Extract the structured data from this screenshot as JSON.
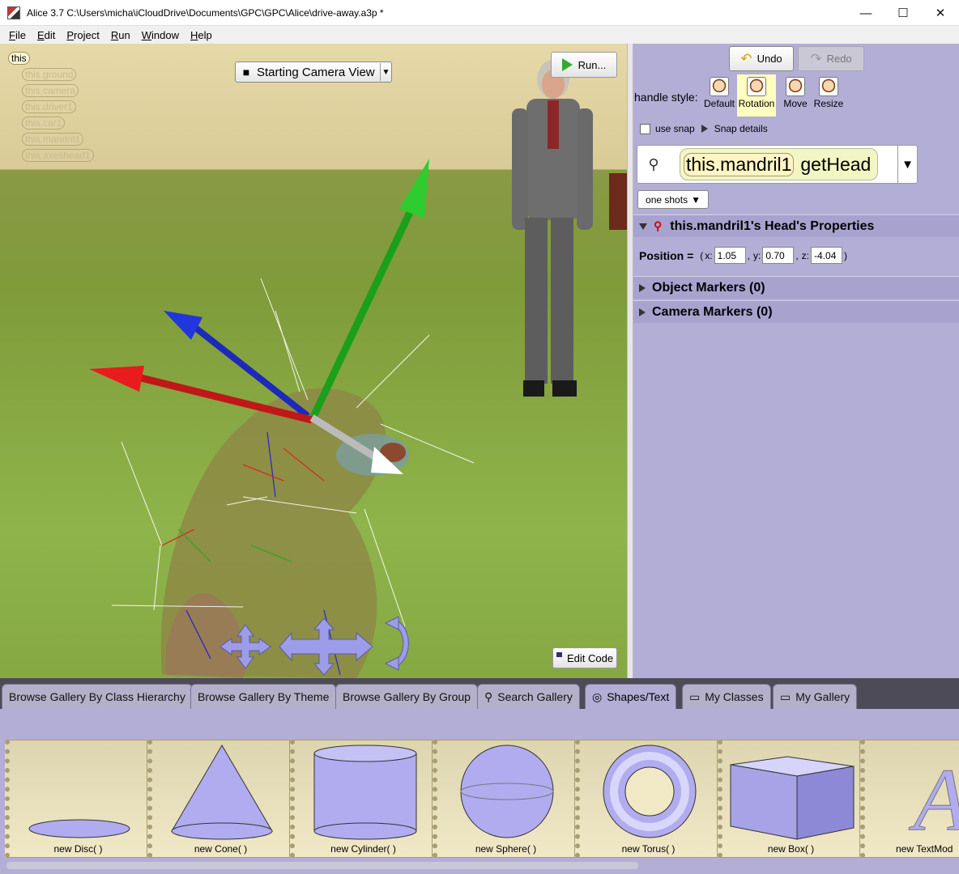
{
  "window": {
    "title": "Alice 3.7 C:\\Users\\micha\\iCloudDrive\\Documents\\GPC\\GPC\\Alice\\drive-away.a3p *",
    "controls": {
      "minimize": "—",
      "maximize": "☐",
      "close": "✕"
    }
  },
  "menu": [
    "File",
    "Edit",
    "Project",
    "Run",
    "Window",
    "Help"
  ],
  "scene": {
    "tree": [
      "this",
      "this.ground",
      "this.camera",
      "this.driver1",
      "this.car1",
      "this.mandril1",
      "this.axeshead1"
    ],
    "camera_view": "Starting Camera View",
    "run_label": "Run...",
    "edit_code_label": "Edit Code"
  },
  "panel": {
    "undo": "Undo",
    "redo": "Redo",
    "handle_style_label": "handle style:",
    "handle_styles": [
      "Default",
      "Rotation",
      "Move",
      "Resize"
    ],
    "selected_handle_style": "Rotation",
    "use_snap": "use snap",
    "snap_details": "Snap details",
    "selector": {
      "object": "this.mandril1",
      "method": "getHead"
    },
    "one_shots": "one shots",
    "properties_title": "this.mandril1's Head's Properties",
    "position": {
      "label": "Position =",
      "x_label": "x:",
      "x": "1.05",
      "y_label": "y:",
      "y": "0.70",
      "z_label": "z:",
      "z": "-4.04"
    },
    "object_markers": "Object Markers (0)",
    "camera_markers": "Camera Markers (0)"
  },
  "gallery": {
    "tabs": [
      "Browse Gallery By Class Hierarchy",
      "Browse Gallery By Theme",
      "Browse Gallery By Group",
      "Search Gallery",
      "Shapes/Text",
      "My Classes",
      "My Gallery"
    ],
    "active_tab": "Shapes/Text",
    "items": [
      "new Disc( )",
      "new Cone( )",
      "new Cylinder( )",
      "new Sphere( )",
      "new Torus( )",
      "new Box( )",
      "new TextMod"
    ]
  },
  "colors": {
    "panel_bg": "#b3aed6",
    "tab_bar": "#4d4b57",
    "ground": "#86a843",
    "sky": "#e6d9a8"
  }
}
